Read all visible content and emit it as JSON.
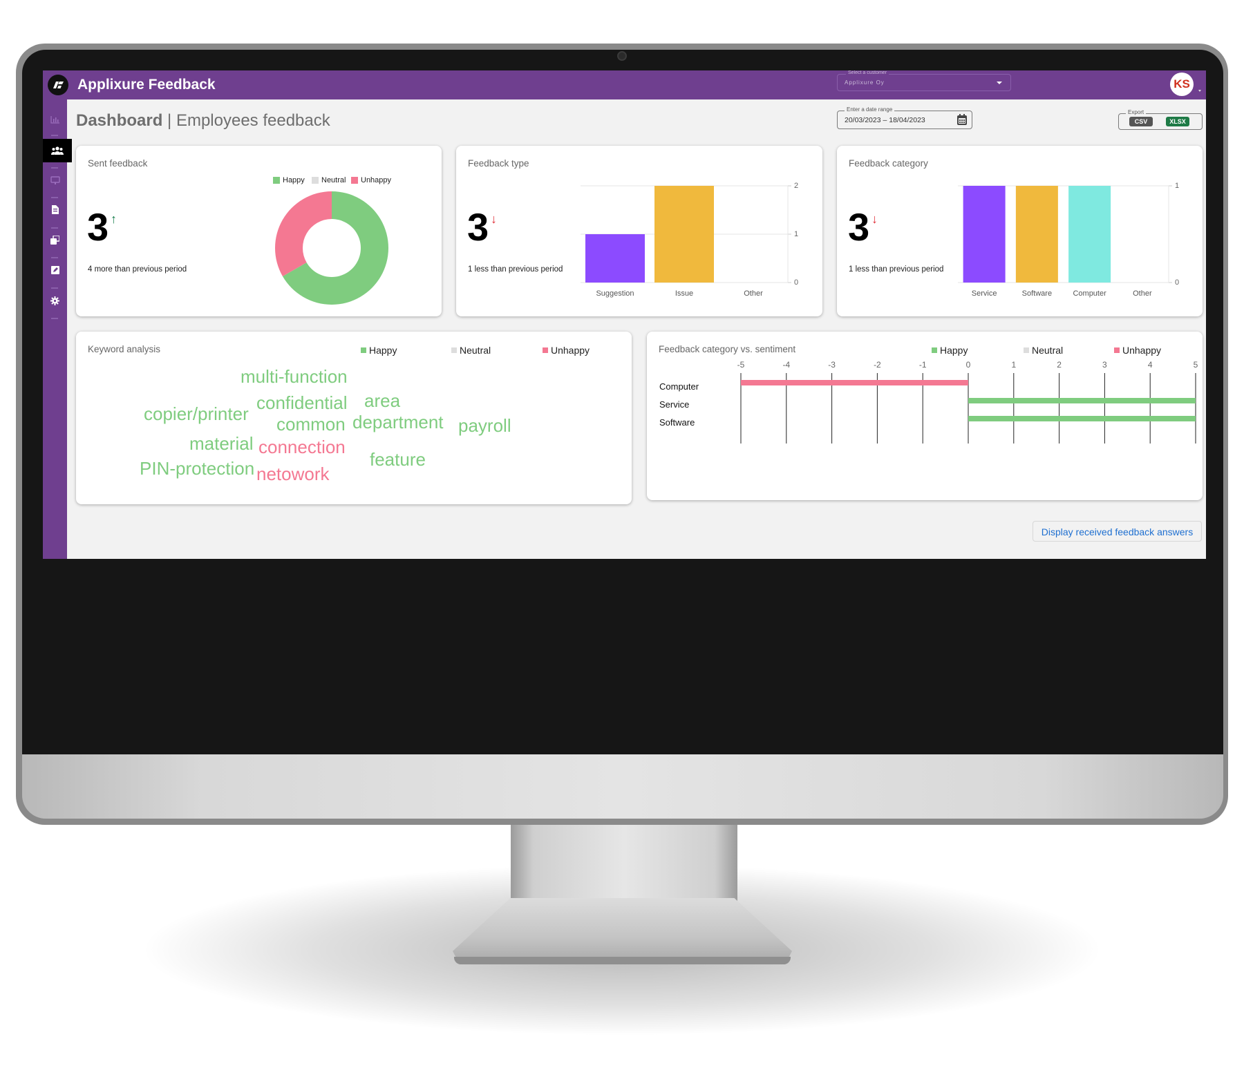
{
  "app": {
    "title": "Applixure Feedback",
    "customer_select": {
      "label": "Select a customer",
      "value": "Applixure Oy"
    },
    "user_initials": "KS"
  },
  "sidebar": {
    "items": [
      {
        "icon": "bar-chart-icon",
        "active": false
      },
      {
        "icon": "users-icon",
        "active": true
      },
      {
        "icon": "monitor-icon",
        "active": false
      },
      {
        "icon": "document-icon",
        "active": false
      },
      {
        "icon": "copy-icon",
        "active": false
      },
      {
        "icon": "edit-icon",
        "active": false
      },
      {
        "icon": "gear-icon",
        "active": false
      }
    ]
  },
  "header": {
    "title_bold": "Dashboard",
    "separator": " | ",
    "subtitle": "Employees feedback",
    "date_range": {
      "label": "Enter a date range",
      "value": "20/03/2023 – 18/04/2023"
    },
    "export": {
      "label": "Export",
      "csv": "CSV",
      "xlsx": "XLSX"
    }
  },
  "colors": {
    "brand": "#6f3f8f",
    "happy": "#7fcc7f",
    "neutral": "#dddddd",
    "unhappy": "#f47892",
    "purple_bar": "#8c4bff",
    "yellow_bar": "#f0b93d",
    "teal_bar": "#7fe9e0",
    "trend_up": "#1a7f4e",
    "trend_down": "#e0303a",
    "link": "#1e6fd0"
  },
  "cards": {
    "sent_feedback": {
      "title": "Sent feedback",
      "value": "3",
      "trend": "↑",
      "trend_dir": "up",
      "subtext": "4 more than previous period"
    },
    "feedback_type": {
      "title": "Feedback type",
      "value": "3",
      "trend": "↓",
      "trend_dir": "down",
      "subtext": "1 less than previous period"
    },
    "feedback_category": {
      "title": "Feedback category",
      "value": "3",
      "trend": "↓",
      "trend_dir": "down",
      "subtext": "1 less than previous period"
    },
    "keyword_analysis": {
      "title": "Keyword analysis",
      "legend": [
        "Happy",
        "Neutral",
        "Unhappy"
      ],
      "words": [
        {
          "text": "multi-function",
          "sentiment": "happy"
        },
        {
          "text": "confidential",
          "sentiment": "happy"
        },
        {
          "text": "area",
          "sentiment": "happy"
        },
        {
          "text": "copier/printer",
          "sentiment": "happy"
        },
        {
          "text": "common",
          "sentiment": "happy"
        },
        {
          "text": "department",
          "sentiment": "happy"
        },
        {
          "text": "payroll",
          "sentiment": "happy"
        },
        {
          "text": "material",
          "sentiment": "happy"
        },
        {
          "text": "connection",
          "sentiment": "unhappy"
        },
        {
          "text": "feature",
          "sentiment": "happy"
        },
        {
          "text": "PIN-protection",
          "sentiment": "happy"
        },
        {
          "text": "netowork",
          "sentiment": "unhappy"
        }
      ]
    },
    "category_vs_sentiment": {
      "title": "Feedback category vs. sentiment",
      "legend": [
        "Happy",
        "Neutral",
        "Unhappy"
      ]
    }
  },
  "chart_data": [
    {
      "type": "pie",
      "title": "Sent feedback",
      "categories": [
        "Happy",
        "Neutral",
        "Unhappy"
      ],
      "values": [
        2,
        0,
        1
      ],
      "legend": "top"
    },
    {
      "type": "bar",
      "title": "Feedback type",
      "categories": [
        "Suggestion",
        "Issue",
        "Other"
      ],
      "values": [
        1,
        2,
        0
      ],
      "ylim": [
        0,
        2
      ],
      "yticks": [
        "0",
        "1",
        "2"
      ],
      "xlabel": "",
      "ylabel": "",
      "grid": true
    },
    {
      "type": "bar",
      "title": "Feedback category",
      "categories": [
        "Service",
        "Software",
        "Computer",
        "Other"
      ],
      "values": [
        1,
        1,
        1,
        0
      ],
      "ylim": [
        0,
        1
      ],
      "yticks": [
        "0",
        "1"
      ],
      "xlabel": "",
      "ylabel": "",
      "grid": true
    },
    {
      "type": "bar",
      "orientation": "horizontal",
      "title": "Feedback category vs. sentiment",
      "categories": [
        "Computer",
        "Service",
        "Software"
      ],
      "series": [
        {
          "name": "Happy",
          "values": [
            0,
            5,
            5
          ]
        },
        {
          "name": "Neutral",
          "values": [
            0,
            0,
            0
          ]
        },
        {
          "name": "Unhappy",
          "values": [
            -5,
            0,
            0
          ]
        }
      ],
      "xlim": [
        -5,
        5
      ],
      "xticks": [
        "-5",
        "-4",
        "-3",
        "-2",
        "-1",
        "0",
        "1",
        "2",
        "3",
        "4",
        "5"
      ],
      "legend": "top-right",
      "grid": true
    }
  ],
  "actions": {
    "display_answers": "Display received feedback answers"
  }
}
